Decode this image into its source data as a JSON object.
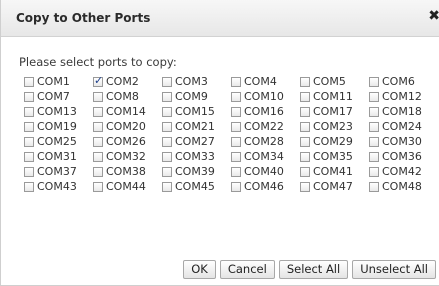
{
  "dialog": {
    "title": "Copy to Other Ports",
    "close_glyph": "✖",
    "close_icon": "close-icon",
    "prompt": "Please select ports to copy:"
  },
  "ports": [
    {
      "label": "COM1",
      "checked": false
    },
    {
      "label": "COM2",
      "checked": true
    },
    {
      "label": "COM3",
      "checked": false
    },
    {
      "label": "COM4",
      "checked": false
    },
    {
      "label": "COM5",
      "checked": false
    },
    {
      "label": "COM6",
      "checked": false
    },
    {
      "label": "COM7",
      "checked": false
    },
    {
      "label": "COM8",
      "checked": false
    },
    {
      "label": "COM9",
      "checked": false
    },
    {
      "label": "COM10",
      "checked": false
    },
    {
      "label": "COM11",
      "checked": false
    },
    {
      "label": "COM12",
      "checked": false
    },
    {
      "label": "COM13",
      "checked": false
    },
    {
      "label": "COM14",
      "checked": false
    },
    {
      "label": "COM15",
      "checked": false
    },
    {
      "label": "COM16",
      "checked": false
    },
    {
      "label": "COM17",
      "checked": false
    },
    {
      "label": "COM18",
      "checked": false
    },
    {
      "label": "COM19",
      "checked": false
    },
    {
      "label": "COM20",
      "checked": false
    },
    {
      "label": "COM21",
      "checked": false
    },
    {
      "label": "COM22",
      "checked": false
    },
    {
      "label": "COM23",
      "checked": false
    },
    {
      "label": "COM24",
      "checked": false
    },
    {
      "label": "COM25",
      "checked": false
    },
    {
      "label": "COM26",
      "checked": false
    },
    {
      "label": "COM27",
      "checked": false
    },
    {
      "label": "COM28",
      "checked": false
    },
    {
      "label": "COM29",
      "checked": false
    },
    {
      "label": "COM30",
      "checked": false
    },
    {
      "label": "COM31",
      "checked": false
    },
    {
      "label": "COM32",
      "checked": false
    },
    {
      "label": "COM33",
      "checked": false
    },
    {
      "label": "COM34",
      "checked": false
    },
    {
      "label": "COM35",
      "checked": false
    },
    {
      "label": "COM36",
      "checked": false
    },
    {
      "label": "COM37",
      "checked": false
    },
    {
      "label": "COM38",
      "checked": false
    },
    {
      "label": "COM39",
      "checked": false
    },
    {
      "label": "COM40",
      "checked": false
    },
    {
      "label": "COM41",
      "checked": false
    },
    {
      "label": "COM42",
      "checked": false
    },
    {
      "label": "COM43",
      "checked": false
    },
    {
      "label": "COM44",
      "checked": false
    },
    {
      "label": "COM45",
      "checked": false
    },
    {
      "label": "COM46",
      "checked": false
    },
    {
      "label": "COM47",
      "checked": false
    },
    {
      "label": "COM48",
      "checked": false
    }
  ],
  "buttons": {
    "ok": "OK",
    "cancel": "Cancel",
    "select_all": "Select All",
    "unselect_all": "Unselect All"
  }
}
